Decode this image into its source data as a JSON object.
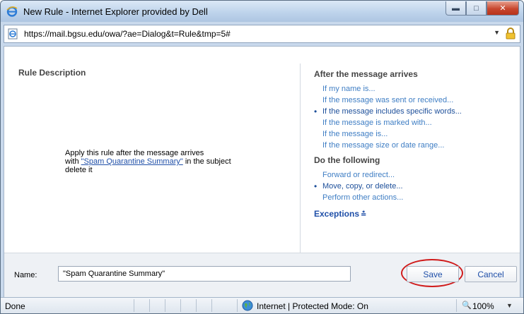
{
  "window": {
    "title": "New Rule - Internet Explorer provided by Dell",
    "url": "https://mail.bgsu.edu/owa/?ae=Dialog&t=Rule&tmp=5#"
  },
  "rule_description": {
    "heading": "Rule Description",
    "line1": "Apply this rule after the message arrives",
    "line2_prefix": "with ",
    "line2_link": "\"Spam Quarantine Summary\"",
    "line2_suffix": " in the subject",
    "line3": "delete it"
  },
  "conditions": {
    "heading": "After the message arrives",
    "items": [
      {
        "label": "If my name is...",
        "selected": false
      },
      {
        "label": "If the message was sent or received...",
        "selected": false
      },
      {
        "label": "If the message includes specific words...",
        "selected": true
      },
      {
        "label": "If the message is marked with...",
        "selected": false
      },
      {
        "label": "If the message is...",
        "selected": false
      },
      {
        "label": "If the message size or date range...",
        "selected": false
      }
    ]
  },
  "actions": {
    "heading": "Do the following",
    "items": [
      {
        "label": "Forward or redirect...",
        "selected": false
      },
      {
        "label": "Move, copy, or delete...",
        "selected": true
      },
      {
        "label": "Perform other actions...",
        "selected": false
      }
    ]
  },
  "exceptions_label": "Exceptions",
  "footer": {
    "name_label": "Name:",
    "name_value": "\"Spam Quarantine Summary\"",
    "save_label": "Save",
    "cancel_label": "Cancel"
  },
  "status": {
    "text": "Done",
    "zone": "Internet | Protected Mode: On",
    "zoom": "100%"
  },
  "colors": {
    "link": "#3f7ec4",
    "selected": "#1d4f9a",
    "annotation_circle": "#d01b1b"
  },
  "icons": [
    "ie-icon",
    "minimize-icon",
    "maximize-icon",
    "close-icon",
    "page-icon",
    "lock-icon",
    "globe-icon",
    "zoom-icon"
  ]
}
